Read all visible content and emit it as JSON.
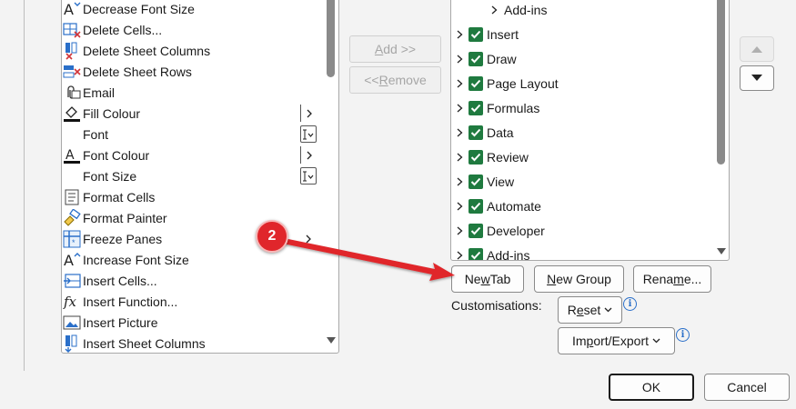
{
  "commands": [
    {
      "label": "Decrease Font Size",
      "icon": "decrease-font-icon",
      "suffix": ""
    },
    {
      "label": "Delete Cells...",
      "icon": "delete-cells-icon",
      "suffix": ""
    },
    {
      "label": "Delete Sheet Columns",
      "icon": "delete-columns-icon",
      "suffix": ""
    },
    {
      "label": "Delete Sheet Rows",
      "icon": "delete-rows-icon",
      "suffix": ""
    },
    {
      "label": "Email",
      "icon": "email-icon",
      "suffix": ""
    },
    {
      "label": "Fill Colour",
      "icon": "fill-colour-icon",
      "suffix": "split"
    },
    {
      "label": "Font",
      "icon": "",
      "suffix": "combo"
    },
    {
      "label": "Font Colour",
      "icon": "font-colour-icon",
      "suffix": "split"
    },
    {
      "label": "Font Size",
      "icon": "",
      "suffix": "combo"
    },
    {
      "label": "Format Cells",
      "icon": "format-cells-icon",
      "suffix": ""
    },
    {
      "label": "Format Painter",
      "icon": "format-painter-icon",
      "suffix": ""
    },
    {
      "label": "Freeze Panes",
      "icon": "freeze-panes-icon",
      "suffix": "submenu"
    },
    {
      "label": "Increase Font Size",
      "icon": "increase-font-icon",
      "suffix": ""
    },
    {
      "label": "Insert Cells...",
      "icon": "insert-cells-icon",
      "suffix": ""
    },
    {
      "label": "Insert Function...",
      "icon": "insert-function-icon",
      "suffix": ""
    },
    {
      "label": "Insert Picture",
      "icon": "insert-picture-icon",
      "suffix": ""
    },
    {
      "label": "Insert Sheet Columns",
      "icon": "insert-columns-icon",
      "suffix": ""
    }
  ],
  "buttons": {
    "add_prefix": "",
    "add_underline": "A",
    "add_rest": "dd >>",
    "remove_prefix": "<< ",
    "remove_underline": "R",
    "remove_rest": "emove",
    "new_tab_prefix": "Ne",
    "new_tab_underline": "w",
    "new_tab_rest": " Tab",
    "new_group_prefix": "",
    "new_group_underline": "N",
    "new_group_rest": "ew Group",
    "rename_prefix": "Rena",
    "rename_underline": "m",
    "rename_rest": "e...",
    "reset_prefix": "R",
    "reset_underline": "e",
    "reset_rest": "set",
    "import_prefix": "Im",
    "import_underline": "p",
    "import_rest": "ort/Export",
    "ok": "OK",
    "cancel": "Cancel"
  },
  "tree": [
    {
      "label": "Add-ins",
      "checked": false,
      "child": true
    },
    {
      "label": "Insert",
      "checked": true,
      "child": false
    },
    {
      "label": "Draw",
      "checked": true,
      "child": false
    },
    {
      "label": "Page Layout",
      "checked": true,
      "child": false
    },
    {
      "label": "Formulas",
      "checked": true,
      "child": false
    },
    {
      "label": "Data",
      "checked": true,
      "child": false
    },
    {
      "label": "Review",
      "checked": true,
      "child": false
    },
    {
      "label": "View",
      "checked": true,
      "child": false
    },
    {
      "label": "Automate",
      "checked": true,
      "child": false
    },
    {
      "label": "Developer",
      "checked": true,
      "child": false
    },
    {
      "label": "Add-ins",
      "checked": true,
      "child": false
    }
  ],
  "customisations_label": "Customisations:",
  "callout_number": "2",
  "colors": {
    "accent_red": "#e0262b",
    "checkbox_green": "#1f7a3f",
    "info_blue": "#2a6fc9"
  }
}
